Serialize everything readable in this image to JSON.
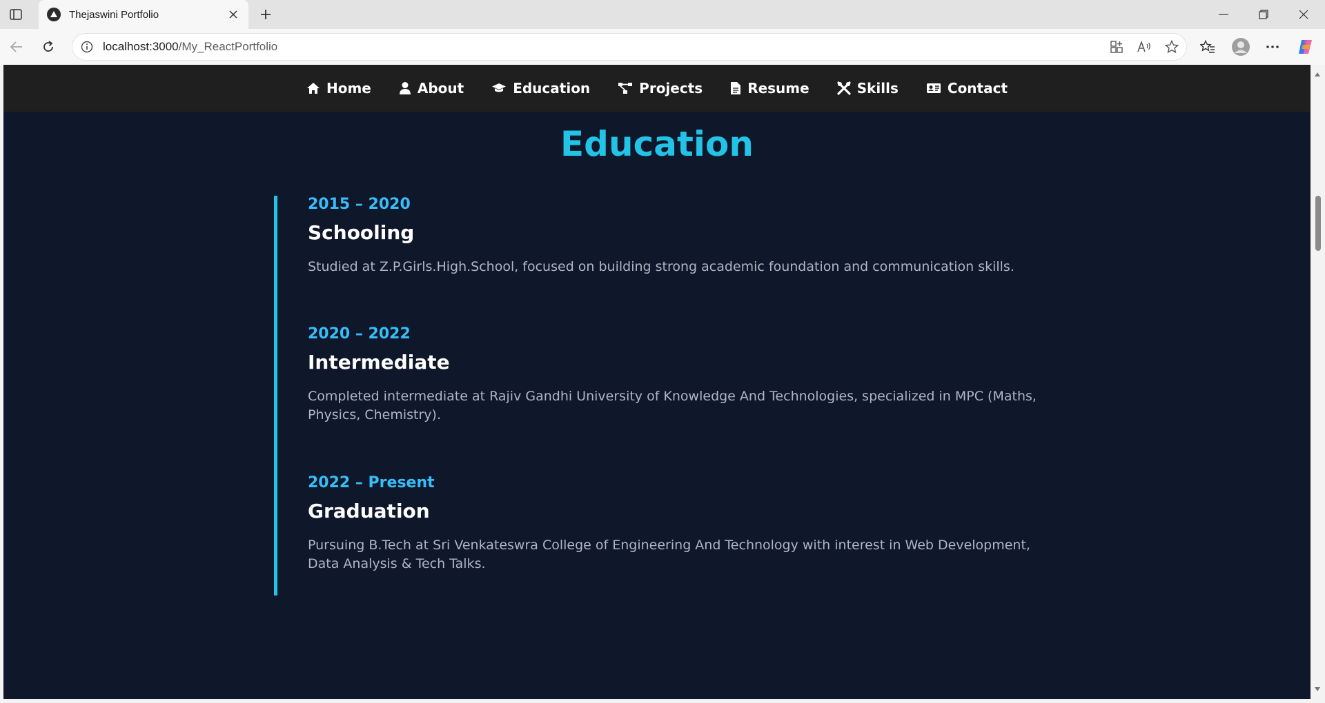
{
  "browser": {
    "tab_title": "Thejaswini Portfolio",
    "url_host": "localhost:3000",
    "url_path": "/My_ReactPortfolio"
  },
  "nav": {
    "items": [
      {
        "label": "Home",
        "icon": "home-icon"
      },
      {
        "label": "About",
        "icon": "user-icon"
      },
      {
        "label": "Education",
        "icon": "graduation-cap-icon"
      },
      {
        "label": "Projects",
        "icon": "project-diagram-icon"
      },
      {
        "label": "Resume",
        "icon": "file-icon"
      },
      {
        "label": "Skills",
        "icon": "tools-icon"
      },
      {
        "label": "Contact",
        "icon": "address-card-icon"
      }
    ]
  },
  "section": {
    "title": "Education"
  },
  "education": [
    {
      "years": "2015 – 2020",
      "heading": "Schooling",
      "description": "Studied at Z.P.Girls.High.School, focused on building strong academic foundation and communication skills."
    },
    {
      "years": "2020 – 2022",
      "heading": "Intermediate",
      "description": "Completed intermediate at Rajiv Gandhi University of Knowledge And Technologies, specialized in MPC (Maths, Physics, Chemistry)."
    },
    {
      "years": "2022 – Present",
      "heading": "Graduation",
      "description": "Pursuing B.Tech at Sri Venkateswra College of Engineering And Technology with interest in Web Development, Data Analysis & Tech Talks."
    }
  ],
  "colors": {
    "page_bg": "#0f172a",
    "nav_bg": "#1f1f1f",
    "accent": "#22c3e6",
    "years": "#38bdf8",
    "text_muted": "#aeb6c4"
  }
}
